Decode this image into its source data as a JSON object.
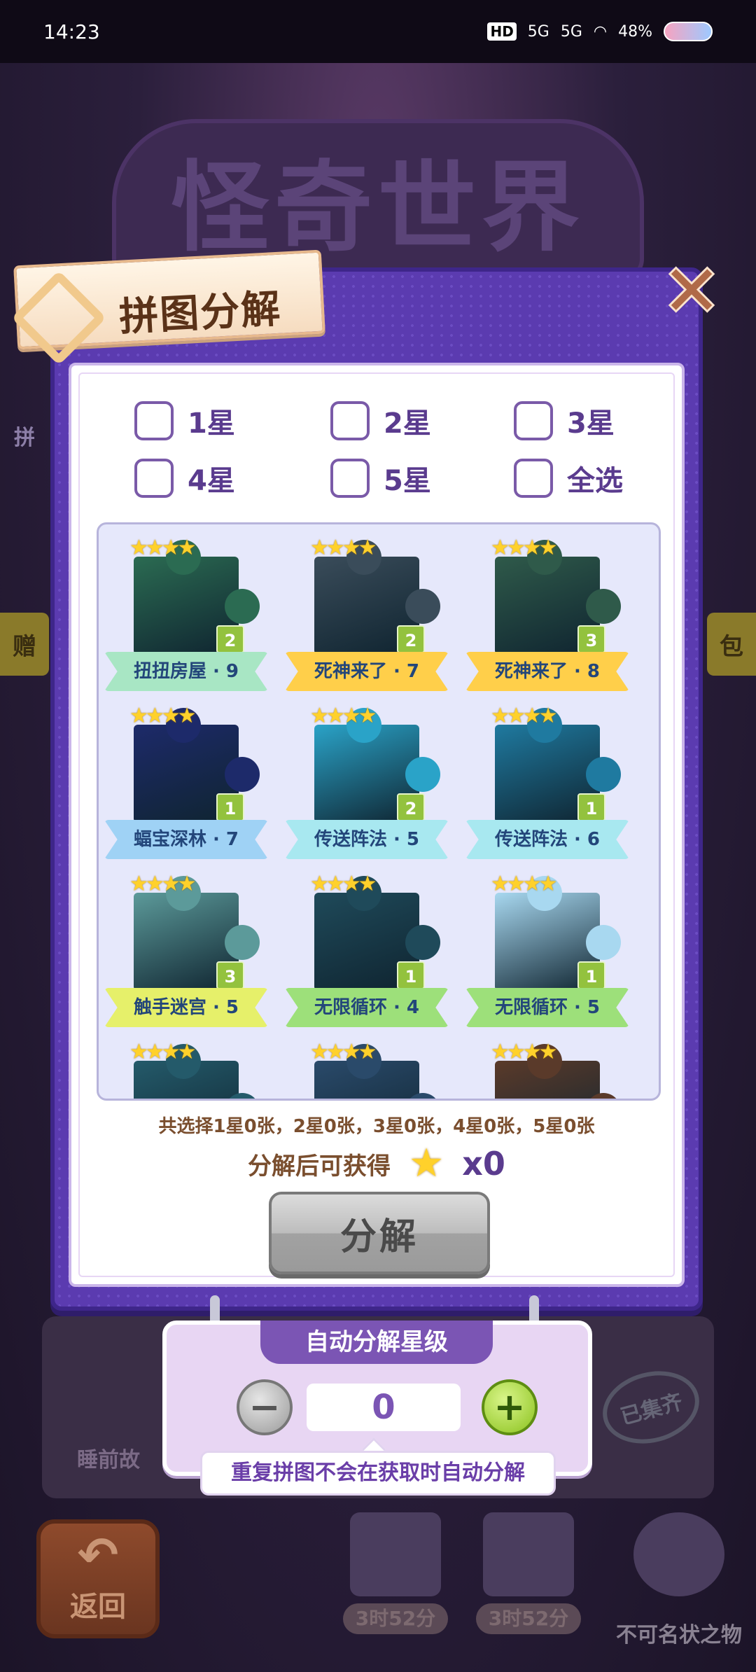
{
  "status_bar": {
    "time": "14:23",
    "hd": "HD",
    "net1": "5G",
    "net2": "5G",
    "battery": "48%"
  },
  "background": {
    "title": "怪奇世界",
    "left_side": "赠",
    "right_side": "包",
    "left_label": "拼",
    "card_label": "睡前故",
    "stamp": "已集齐",
    "back_label": "返回",
    "timer1": "3时52分",
    "timer2": "3时52分",
    "ghost_label": "不可名状之物"
  },
  "dialog": {
    "title": "拼图分解",
    "close_icon": "close-x-icon",
    "checkboxes": [
      "1星",
      "2星",
      "3星",
      "4星",
      "5星",
      "全选"
    ],
    "pieces": [
      {
        "stars": "★★★★",
        "count": "2",
        "label": "扭扭房屋 · 9",
        "ribbon": "#a8e6c4",
        "img": "#2b6b52"
      },
      {
        "stars": "★★★★",
        "count": "2",
        "label": "死神来了 · 7",
        "ribbon": "#ffcf4a",
        "img": "#3a4c5a"
      },
      {
        "stars": "★★★★",
        "count": "3",
        "label": "死神来了 · 8",
        "ribbon": "#ffcf4a",
        "img": "#2f5a4a"
      },
      {
        "stars": "★★★★",
        "count": "1",
        "label": "蝠宝深林 · 7",
        "ribbon": "#9fd2f5",
        "img": "#1d2a6a"
      },
      {
        "stars": "★★★★",
        "count": "2",
        "label": "传送阵法 · 5",
        "ribbon": "#a8e8f0",
        "img": "#2aa3c8"
      },
      {
        "stars": "★★★★",
        "count": "1",
        "label": "传送阵法 · 6",
        "ribbon": "#a8e8f0",
        "img": "#1f7aa0"
      },
      {
        "stars": "★★★★",
        "count": "3",
        "label": "触手迷宫 · 5",
        "ribbon": "#e6f06a",
        "img": "#5c9a9a"
      },
      {
        "stars": "★★★★",
        "count": "1",
        "label": "无限循环 · 4",
        "ribbon": "#9de07a",
        "img": "#1f4a5a"
      },
      {
        "stars": "★★★★",
        "count": "1",
        "label": "无限循环 · 5",
        "ribbon": "#9de07a",
        "img": "#a8d8f0"
      },
      {
        "stars": "★★★★",
        "count": "",
        "label": "",
        "ribbon": "",
        "img": "#245a6a"
      },
      {
        "stars": "★★★★",
        "count": "",
        "label": "",
        "ribbon": "",
        "img": "#2a4a6a"
      },
      {
        "stars": "★★★★",
        "count": "",
        "label": "",
        "ribbon": "",
        "img": "#5a3a2a"
      }
    ],
    "summary": "共选择1星0张，2星0张，3星0张，4星0张，5星0张",
    "reward_label": "分解后可获得",
    "reward_count": "x0",
    "decompose_button": "分解"
  },
  "auto": {
    "title": "自动分解星级",
    "value": "0",
    "note": "重复拼图不会在获取时自动分解"
  }
}
